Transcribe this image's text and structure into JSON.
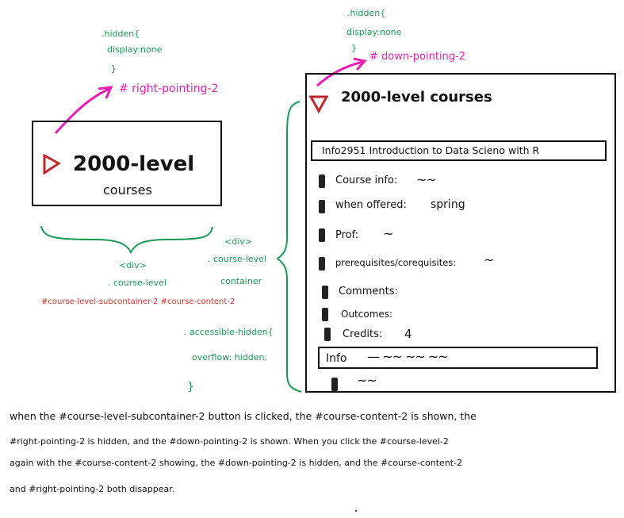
{
  "left_block": {
    "hidden_note": ".hidden{",
    "display_note": "display:none",
    "close_brace": "}",
    "right_pointing_label": "# right-pointing-2",
    "triangle_icon": "right-pointing-triangle-icon",
    "title_line1": "2000-level",
    "title_line2": "courses",
    "div_label": "<div>",
    "class_label": ". course-level",
    "id_label": "#course-level-subcontainer-2 #course-content-2"
  },
  "middle_notes": {
    "div_label": "<div>",
    "class_label": ". course-level",
    "container_label": "container",
    "accessible_label": ". accessible-hidden{",
    "overflow_label": "overflow: hidden;",
    "close_brace": "}"
  },
  "right_block": {
    "hidden_note": ".hidden{",
    "display_note": "display:none",
    "close_brace": "}",
    "down_pointing_label": "# down-pointing-2",
    "triangle_icon": "down-pointing-triangle-icon",
    "title": "2000-level courses",
    "course_bar": "Info2951  Introduction to Data Scieno with R",
    "fields": [
      {
        "label": "Course info:",
        "value": "~~"
      },
      {
        "label": "when offered:",
        "value": "spring"
      },
      {
        "label": "Prof:",
        "value": "~"
      },
      {
        "label": "prerequisites/corequisites:",
        "value": "~"
      },
      {
        "label": "Comments:",
        "value": ""
      },
      {
        "label": "Outcomes:",
        "value": ""
      },
      {
        "label": "Credits:",
        "value": "4"
      }
    ],
    "info_bar_label": "Info",
    "info_bar_squiggles": "—     ~~      ~~      ~~",
    "bottom_squiggle": "~~"
  },
  "description": {
    "line1": "when the #course-level-subcontainer-2 button is clicked, the #course-content-2 is shown, the",
    "line2": "#right-pointing-2 is hidden, and the #down-pointing-2 is shown. When you click the #course-level-2",
    "line3": "again with the #course-content-2 showing, the #down-pointing-2 is hidden, and the #course-content-2",
    "line4": "and #right-pointing-2 both disappear."
  },
  "colors": {
    "green": "#1a9a55",
    "magenta": "#e61fb4",
    "red": "#d8312a",
    "triangle_red": "#c0262b"
  }
}
